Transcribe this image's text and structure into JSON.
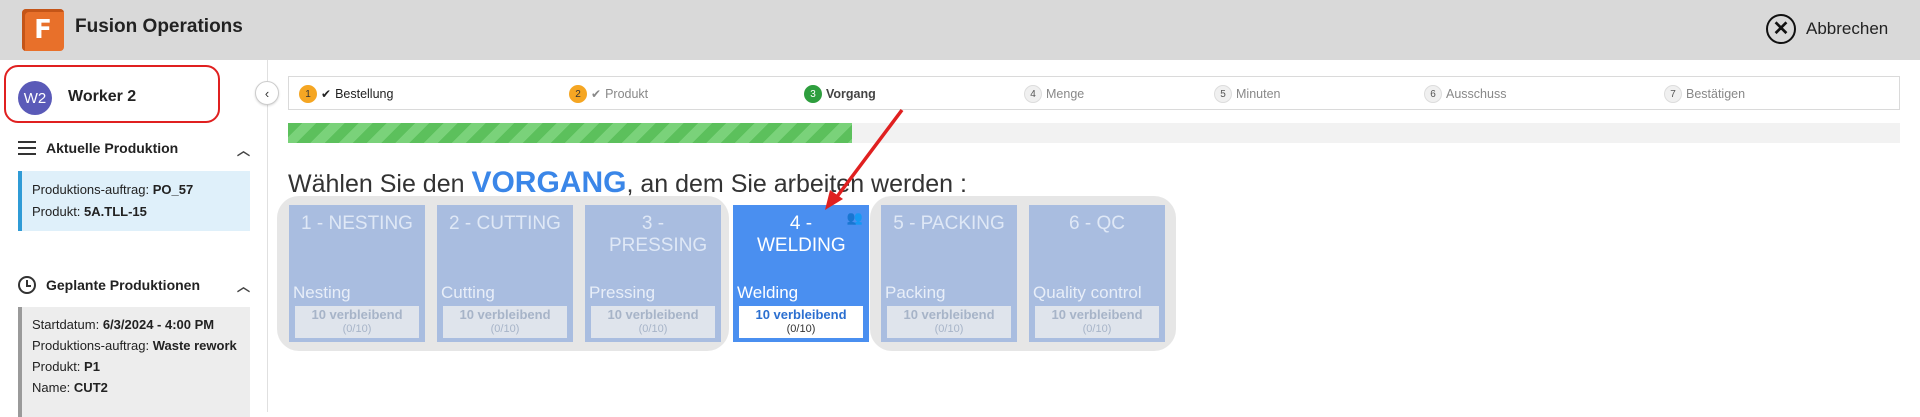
{
  "header": {
    "logo_letter": "F",
    "title": "Fusion Operations",
    "cancel_label": "Abbrechen"
  },
  "sidebar": {
    "worker": {
      "initials": "W2",
      "name": "Worker 2"
    },
    "current": {
      "heading": "Aktuelle Produktion",
      "order_label": "Produktions-auftrag:",
      "order_value": "PO_57",
      "product_label": "Produkt:",
      "product_value": "5A.TLL-15"
    },
    "planned": {
      "heading": "Geplante Produktionen",
      "start_label": "Startdatum:",
      "start_value": "6/3/2024 - 4:00 PM",
      "order_label": "Produktions-auftrag:",
      "order_value": "Waste rework",
      "product_label": "Produkt:",
      "product_value": "P1",
      "extra_label": "Name:",
      "extra_value": "CUT2"
    }
  },
  "stepper": {
    "steps": [
      {
        "num": "1",
        "label": "Bestellung",
        "state": "done"
      },
      {
        "num": "2",
        "label": "Produkt",
        "state": "done"
      },
      {
        "num": "3",
        "label": "Vorgang",
        "state": "current"
      },
      {
        "num": "4",
        "label": "Menge",
        "state": "todo"
      },
      {
        "num": "5",
        "label": "Minuten",
        "state": "todo"
      },
      {
        "num": "6",
        "label": "Ausschuss",
        "state": "todo"
      },
      {
        "num": "7",
        "label": "Bestätigen",
        "state": "todo"
      }
    ]
  },
  "progress": {
    "fraction": 0.35
  },
  "main": {
    "heading_pre": "Wählen Sie den ",
    "heading_kw": "VORGANG",
    "heading_post": ", an dem Sie arbeiten werden :"
  },
  "operations": [
    {
      "title": "1 - NESTING",
      "name": "Nesting",
      "remaining": "10 verbleibend",
      "count": "(0/10)",
      "active": false
    },
    {
      "title": "2 - CUTTING",
      "name": "Cutting",
      "remaining": "10 verbleibend",
      "count": "(0/10)",
      "active": false
    },
    {
      "title": "3 - PRESSING",
      "name": "Pressing",
      "remaining": "10 verbleibend",
      "count": "(0/10)",
      "active": false
    },
    {
      "title": "4 - WELDING",
      "name": "Welding",
      "remaining": "10 verbleibend",
      "count": "(0/10)",
      "active": true
    },
    {
      "title": "5 - PACKING",
      "name": "Packing",
      "remaining": "10 verbleibend",
      "count": "(0/10)",
      "active": false
    },
    {
      "title": "6 - QC",
      "name": "Quality control",
      "remaining": "10 verbleibend",
      "count": "(0/10)",
      "active": false
    }
  ],
  "colors": {
    "accent": "#4a8ff0",
    "annotation": "#e02020",
    "step_done": "#f5a623",
    "step_current": "#2e9e3e"
  },
  "icons": {
    "logo": "fusion-logo-icon",
    "cancel": "close-circle-icon",
    "collapse": "chevron-left-icon",
    "current_section": "menu-icon",
    "planned_section": "clock-icon",
    "active_tile": "people-icon"
  }
}
